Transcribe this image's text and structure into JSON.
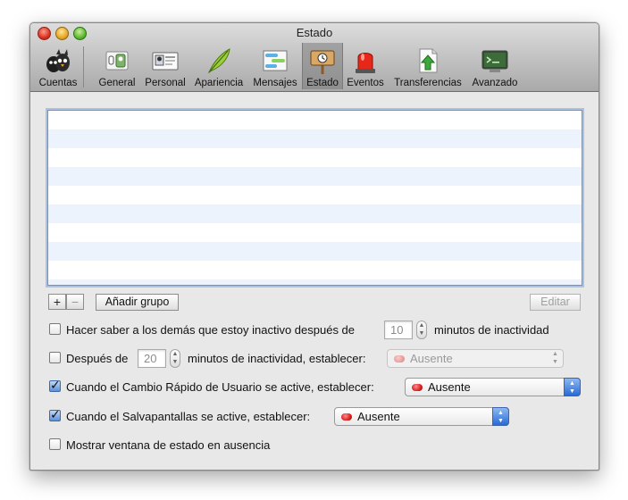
{
  "window": {
    "title": "Estado"
  },
  "toolbar": {
    "items": [
      {
        "label": "Cuentas",
        "icon": "accounts-icon"
      },
      {
        "label": "General",
        "icon": "general-icon"
      },
      {
        "label": "Personal",
        "icon": "personal-icon"
      },
      {
        "label": "Apariencia",
        "icon": "feather-icon"
      },
      {
        "label": "Mensajes",
        "icon": "messages-icon"
      },
      {
        "label": "Estado",
        "icon": "status-sign-icon",
        "selected": true
      },
      {
        "label": "Eventos",
        "icon": "siren-icon"
      },
      {
        "label": "Transferencias",
        "icon": "transfer-icon"
      },
      {
        "label": "Avanzado",
        "icon": "terminal-icon"
      }
    ]
  },
  "list": {
    "rows": []
  },
  "buttons": {
    "add": "+",
    "remove": "−",
    "add_group": "Añadir grupo",
    "edit": "Editar"
  },
  "options": {
    "idle": {
      "checked": false,
      "label": "Hacer saber a los demás que estoy inactivo después de",
      "value": "10",
      "suffix": "minutos de inactividad"
    },
    "after": {
      "checked": false,
      "prefix": "Después de",
      "value": "20",
      "label": "minutos de inactividad, establecer:",
      "status": "Ausente"
    },
    "fast_switch": {
      "checked": true,
      "label": "Cuando el Cambio Rápido de Usuario se active, establecer:",
      "status": "Ausente"
    },
    "screensaver": {
      "checked": true,
      "label": "Cuando el Salvapantallas se active, establecer:",
      "status": "Ausente"
    },
    "show_window": {
      "checked": false,
      "label": "Mostrar ventana de estado en ausencia"
    }
  },
  "colors": {
    "away": "#d01010",
    "accent": "#2a6ad6",
    "list_stripe": "#edf3fc"
  }
}
